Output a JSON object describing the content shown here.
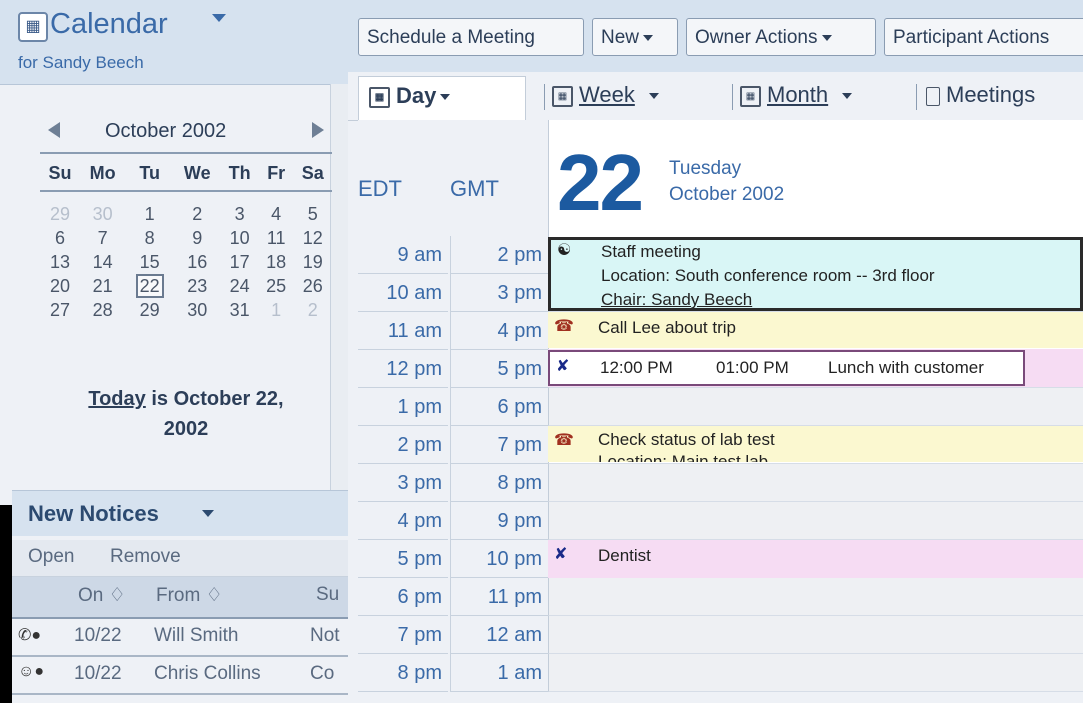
{
  "calendar": {
    "title": "Calendar",
    "owner": "for Sandy Beech"
  },
  "mini": {
    "month_label": "October  2002",
    "weekdays": [
      "Su",
      "Mo",
      "Tu",
      "We",
      "Th",
      "Fr",
      "Sa"
    ],
    "weeks": [
      [
        {
          "d": "29",
          "o": true
        },
        {
          "d": "30",
          "o": true
        },
        {
          "d": "1"
        },
        {
          "d": "2"
        },
        {
          "d": "3"
        },
        {
          "d": "4"
        },
        {
          "d": "5"
        }
      ],
      [
        {
          "d": "6"
        },
        {
          "d": "7"
        },
        {
          "d": "8"
        },
        {
          "d": "9"
        },
        {
          "d": "10"
        },
        {
          "d": "11"
        },
        {
          "d": "12"
        }
      ],
      [
        {
          "d": "13"
        },
        {
          "d": "14"
        },
        {
          "d": "15"
        },
        {
          "d": "16"
        },
        {
          "d": "17"
        },
        {
          "d": "18"
        },
        {
          "d": "19"
        }
      ],
      [
        {
          "d": "20"
        },
        {
          "d": "21"
        },
        {
          "d": "22",
          "t": true
        },
        {
          "d": "23"
        },
        {
          "d": "24"
        },
        {
          "d": "25"
        },
        {
          "d": "26"
        }
      ],
      [
        {
          "d": "27"
        },
        {
          "d": "28"
        },
        {
          "d": "29"
        },
        {
          "d": "30"
        },
        {
          "d": "31"
        },
        {
          "d": "1",
          "o": true
        },
        {
          "d": "2",
          "o": true
        }
      ]
    ],
    "today_link": "Today",
    "today_text": " is October 22,",
    "today_year": "2002"
  },
  "notices": {
    "title": "New Notices",
    "open": "Open",
    "remove": "Remove",
    "col_on": "On ♢",
    "col_from": "From ♢",
    "col_subject": "Su",
    "rows": [
      {
        "icon": "✆●",
        "on": "10/22",
        "from": "Will Smith",
        "subject": "Not"
      },
      {
        "icon": "☺●",
        "on": "10/22",
        "from": "Chris Collins",
        "subject": "Co"
      }
    ]
  },
  "toolbar": {
    "schedule": "Schedule a Meeting",
    "new": "New",
    "owner_actions": "Owner Actions",
    "participant_actions": "Participant Actions"
  },
  "tabs": {
    "day": "Day",
    "week": "Week",
    "month": "Month",
    "meetings": "Meetings"
  },
  "day_header": {
    "tz1": "EDT",
    "tz2": "GMT",
    "day_number": "22",
    "weekday": "Tuesday",
    "month_year": "October 2002"
  },
  "hours": [
    {
      "edt": "9 am",
      "gmt": "2 pm"
    },
    {
      "edt": "10 am",
      "gmt": "3 pm"
    },
    {
      "edt": "11 am",
      "gmt": "4 pm"
    },
    {
      "edt": "12 pm",
      "gmt": "5 pm"
    },
    {
      "edt": "1 pm",
      "gmt": "6 pm"
    },
    {
      "edt": "2 pm",
      "gmt": "7 pm"
    },
    {
      "edt": "3 pm",
      "gmt": "8 pm"
    },
    {
      "edt": "4 pm",
      "gmt": "9 pm"
    },
    {
      "edt": "5 pm",
      "gmt": "10 pm"
    },
    {
      "edt": "6 pm",
      "gmt": "11 pm"
    },
    {
      "edt": "7 pm",
      "gmt": "12 am"
    },
    {
      "edt": "8 pm",
      "gmt": "1 am"
    }
  ],
  "appointments": {
    "staff": {
      "title": "Staff meeting",
      "location": "Location: South conference room -- 3rd floor",
      "chair": "Chair: Sandy Beech",
      "color": "#d9f6f6"
    },
    "call": {
      "title": "Call Lee about trip",
      "color": "#fbf8d0"
    },
    "lunch": {
      "start": "12:00 PM",
      "end": "01:00 PM",
      "title": "Lunch with customer",
      "color": "#f6dcf3"
    },
    "lab": {
      "title": "Check status of lab test",
      "location": "Location: Main test lab",
      "color": "#fbf8d0"
    },
    "dentist": {
      "title": "Dentist",
      "color": "#f6dcf3"
    }
  }
}
